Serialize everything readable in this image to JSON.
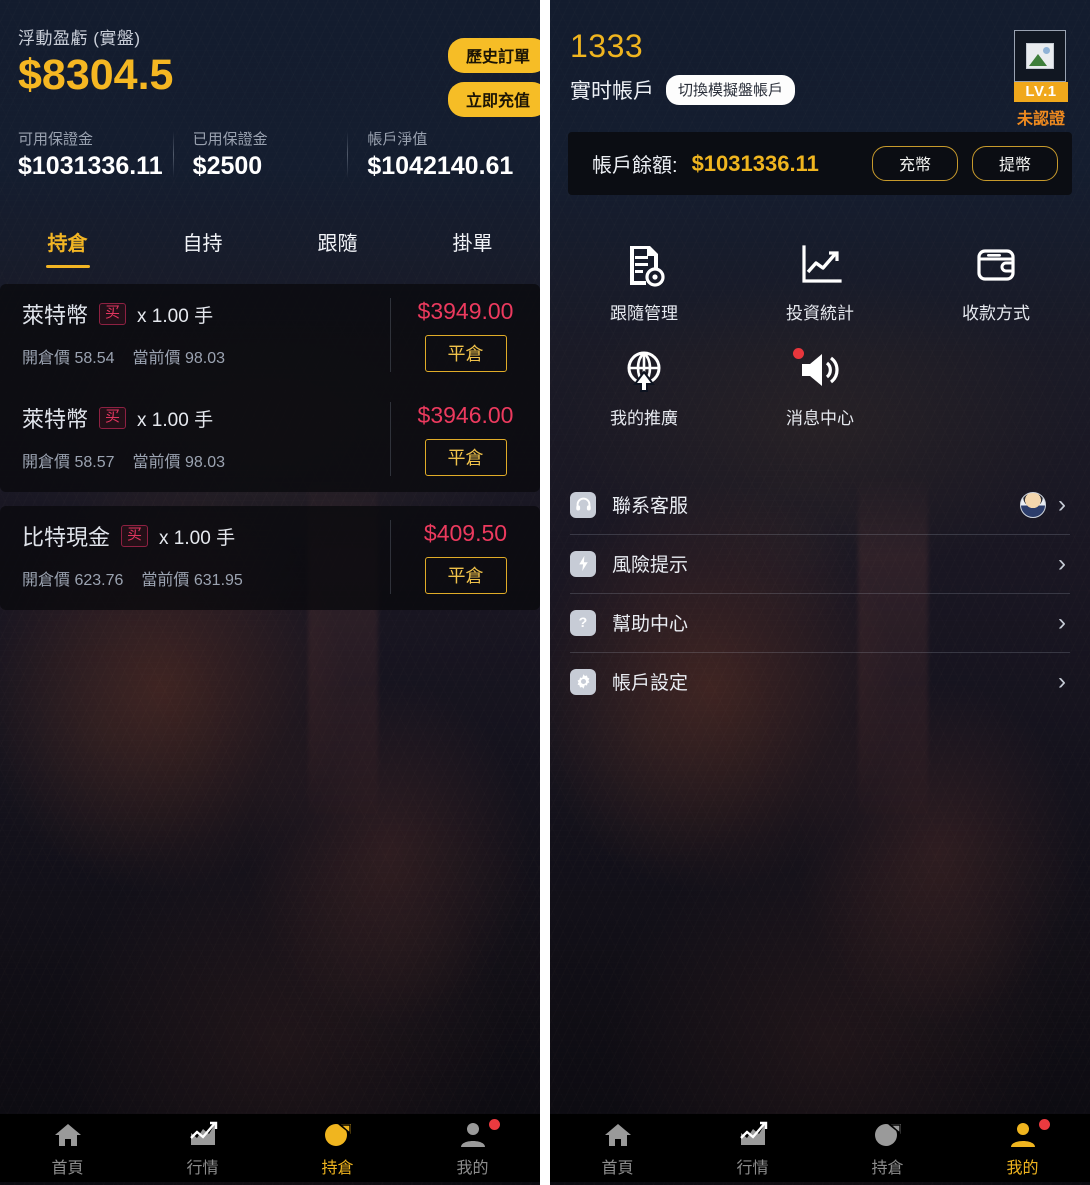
{
  "colors": {
    "gold": "#f0b51f",
    "gold_btn": "#f6bd26",
    "red_pnl": "#ec3a5e",
    "badge_buy": "#e0365f",
    "panel_bg": "#0d1320",
    "nav_bg": "#000000",
    "nav_inactive": "#8d8d8d",
    "dot_red": "#ea3a3f"
  },
  "left_panel": {
    "pnl_label": "浮動盈虧 (實盤)",
    "pnl_value": "$8304.5",
    "buttons": {
      "history_orders": "歷史訂單",
      "deposit_now": "立即充值"
    },
    "stats": [
      {
        "label": "可用保證金",
        "value": "$1031336.11"
      },
      {
        "label": "已用保證金",
        "value": "$2500"
      },
      {
        "label": "帳戶淨值",
        "value": "$1042140.61"
      }
    ],
    "tabs": [
      {
        "label": "持倉",
        "active": true
      },
      {
        "label": "自持",
        "active": false
      },
      {
        "label": "跟隨",
        "active": false
      },
      {
        "label": "掛單",
        "active": false
      }
    ],
    "positions": [
      {
        "symbol": "萊特幣",
        "side": "买",
        "qty": "x 1.00 手",
        "open_label": "開倉價",
        "open_price": "58.54",
        "current_label": "當前價",
        "current_price": "98.03",
        "pnl": "$3949.00",
        "close_button": "平倉"
      },
      {
        "symbol": "萊特幣",
        "side": "买",
        "qty": "x 1.00 手",
        "open_label": "開倉價",
        "open_price": "58.57",
        "current_label": "當前價",
        "current_price": "98.03",
        "pnl": "$3946.00",
        "close_button": "平倉"
      },
      {
        "symbol": "比特現金",
        "side": "买",
        "qty": "x 1.00 手",
        "open_label": "開倉價",
        "open_price": "623.76",
        "current_label": "當前價",
        "current_price": "631.95",
        "pnl": "$409.50",
        "close_button": "平倉"
      }
    ],
    "bottom_nav": [
      {
        "label": "首頁",
        "icon": "home-icon",
        "active": false,
        "dot": false
      },
      {
        "label": "行情",
        "icon": "chart-icon",
        "active": false,
        "dot": false
      },
      {
        "label": "持倉",
        "icon": "pie-icon",
        "active": true,
        "dot": false
      },
      {
        "label": "我的",
        "icon": "user-icon",
        "active": false,
        "dot": true
      }
    ]
  },
  "right_panel": {
    "user_id": "1333",
    "account_type": "實时帳戶",
    "switch_account": "切換模擬盤帳戶",
    "level_badge": "LV.1",
    "verify_status": "未認證",
    "balance_label": "帳戶餘額:",
    "balance_value": "$1031336.11",
    "balance_buttons": {
      "deposit": "充幣",
      "withdraw": "提幣"
    },
    "grid": [
      {
        "label": "跟隨管理",
        "icon": "document-gear-icon",
        "dot": false
      },
      {
        "label": "投資統計",
        "icon": "line-chart-icon",
        "dot": false
      },
      {
        "label": "收款方式",
        "icon": "wallet-icon",
        "dot": false
      },
      {
        "label": "我的推廣",
        "icon": "globe-share-icon",
        "dot": false
      },
      {
        "label": "消息中心",
        "icon": "speaker-icon",
        "dot": true
      }
    ],
    "menu": [
      {
        "label": "聯系客服",
        "icon": "headset-icon",
        "avatar": true
      },
      {
        "label": "風險提示",
        "icon": "lightning-icon",
        "avatar": false
      },
      {
        "label": "幫助中心",
        "icon": "question-icon",
        "avatar": false
      },
      {
        "label": "帳戶設定",
        "icon": "gear-icon",
        "avatar": false
      }
    ],
    "bottom_nav": [
      {
        "label": "首頁",
        "icon": "home-icon",
        "active": false,
        "dot": false
      },
      {
        "label": "行情",
        "icon": "chart-icon",
        "active": false,
        "dot": false
      },
      {
        "label": "持倉",
        "icon": "pie-icon",
        "active": false,
        "dot": false
      },
      {
        "label": "我的",
        "icon": "user-icon",
        "active": true,
        "dot": true
      }
    ]
  }
}
